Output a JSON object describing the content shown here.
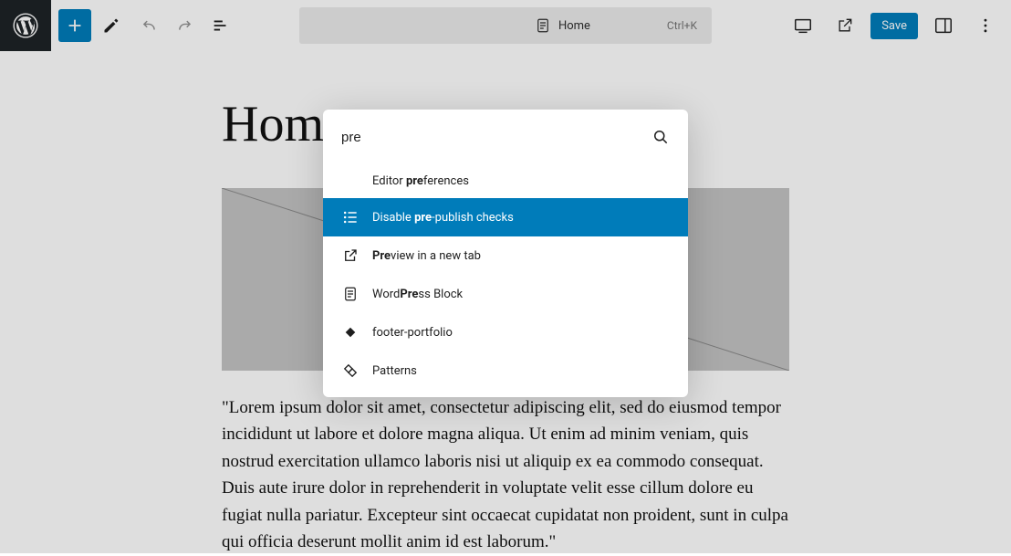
{
  "toolbar": {
    "page_label": "Home",
    "shortcut": "Ctrl+K",
    "save_label": "Save"
  },
  "page": {
    "title": "Home",
    "body": "\"Lorem ipsum dolor sit amet, consectetur adipiscing elit, sed do eiusmod tempor incididunt ut labore et dolore magna aliqua. Ut enim ad minim veniam, quis nostrud exercitation ullamco laboris nisi ut aliquip ex ea commodo consequat. Duis aute irure dolor in reprehenderit in voluptate velit esse cillum dolore eu fugiat nulla pariatur. Excepteur sint occaecat cupidatat non proident, sunt in culpa qui officia deserunt mollit anim id est laborum.\""
  },
  "palette": {
    "query": "pre",
    "items": [
      {
        "pre": "Editor ",
        "match": "pre",
        "post": "ferences",
        "icon": ""
      },
      {
        "pre": "Disable ",
        "match": "pre",
        "post": "-publish checks",
        "icon": "list"
      },
      {
        "pre": "",
        "match": "Pre",
        "post": "view in a new tab",
        "icon": "external"
      },
      {
        "pre": "Word",
        "match": "Pre",
        "post": "ss Block",
        "icon": "page"
      },
      {
        "pre": "footer-portfolio",
        "match": "",
        "post": "",
        "icon": "diamond"
      },
      {
        "pre": "Patterns",
        "match": "",
        "post": "",
        "icon": "diamonds"
      }
    ],
    "selected": 1
  },
  "colors": {
    "accent": "#007cba"
  }
}
